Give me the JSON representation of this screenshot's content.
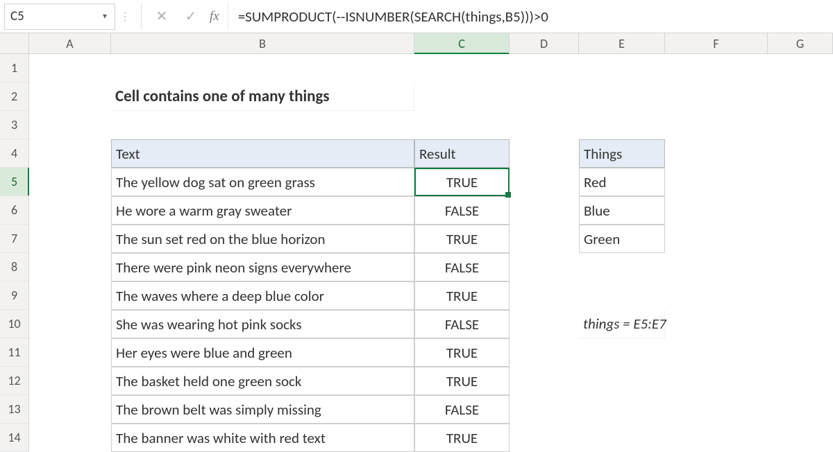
{
  "name_box": "C5",
  "fx_label": "fx",
  "formula": "=SUMPRODUCT(--ISNUMBER(SEARCH(things,B5)))>0",
  "col_headers": [
    "A",
    "B",
    "C",
    "D",
    "E",
    "F",
    "G"
  ],
  "active_col": "C",
  "row_headers": [
    "1",
    "2",
    "3",
    "4",
    "5",
    "6",
    "7",
    "8",
    "9",
    "10",
    "11",
    "12",
    "13",
    "14"
  ],
  "active_row": "5",
  "title": "Cell contains one of many things",
  "table": {
    "head_text": "Text",
    "head_result": "Result",
    "rows": [
      {
        "text": "The yellow dog sat on green grass",
        "result": "TRUE"
      },
      {
        "text": "He wore a warm gray sweater",
        "result": "FALSE"
      },
      {
        "text": "The sun set red on the blue horizon",
        "result": "TRUE"
      },
      {
        "text": "There were pink neon signs everywhere",
        "result": "FALSE"
      },
      {
        "text": "The waves where a deep blue color",
        "result": "TRUE"
      },
      {
        "text": "She was wearing hot pink socks",
        "result": "FALSE"
      },
      {
        "text": "Her eyes were blue and green",
        "result": "TRUE"
      },
      {
        "text": "The basket held one green sock",
        "result": "TRUE"
      },
      {
        "text": "The brown belt was simply missing",
        "result": "FALSE"
      },
      {
        "text": "The banner was white with red text",
        "result": "TRUE"
      }
    ]
  },
  "things": {
    "head": "Things",
    "items": [
      "Red",
      "Blue",
      "Green"
    ]
  },
  "note": "things = E5:E7"
}
